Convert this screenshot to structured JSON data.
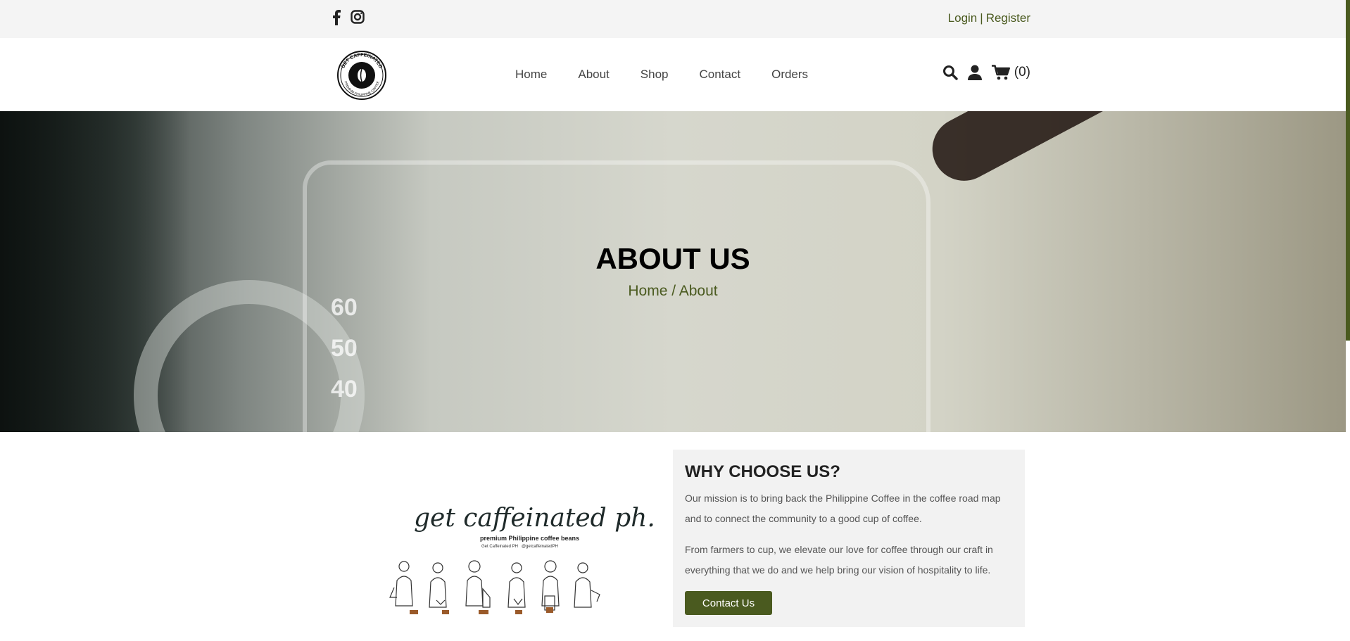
{
  "topbar": {
    "social_icons": [
      "facebook-icon",
      "instagram-icon"
    ],
    "login_label": "Login",
    "separator": "|",
    "register_label": "Register"
  },
  "header": {
    "logo_text": "GET CAFFEINATED",
    "logo_subtext": "PREMIUM PHILIPPINE COFFEE",
    "nav": [
      "Home",
      "About",
      "Shop",
      "Contact",
      "Orders"
    ],
    "icons": [
      "search-icon",
      "user-icon",
      "cart-icon"
    ],
    "cart_count": "(0)"
  },
  "hero": {
    "title": "ABOUT US",
    "breadcrumb_home": "Home",
    "breadcrumb_sep": " / ",
    "breadcrumb_current": "About",
    "cup_marks": [
      "60",
      "50",
      "40"
    ]
  },
  "brand": {
    "script": "get caffeinated ph.",
    "tagline": "premium Philippine coffee beans",
    "facebook_handle": "Get Caffeinated PH",
    "instagram_handle": "@getcaffeinatedPH"
  },
  "why": {
    "heading": "WHY CHOOSE US?",
    "paragraph1": "Our mission is to bring back the Philippine Coffee in the coffee road map and to connect the community to a good cup of coffee.",
    "paragraph2": "From farmers to cup, we elevate our love for coffee through our craft in everything that we do and we help bring our vision of hospitality to life.",
    "button_label": "Contact Us"
  },
  "colors": {
    "accent": "#4a5a1f",
    "topbar_bg": "#f4f4f4",
    "panel_bg": "#f2f2f2"
  }
}
